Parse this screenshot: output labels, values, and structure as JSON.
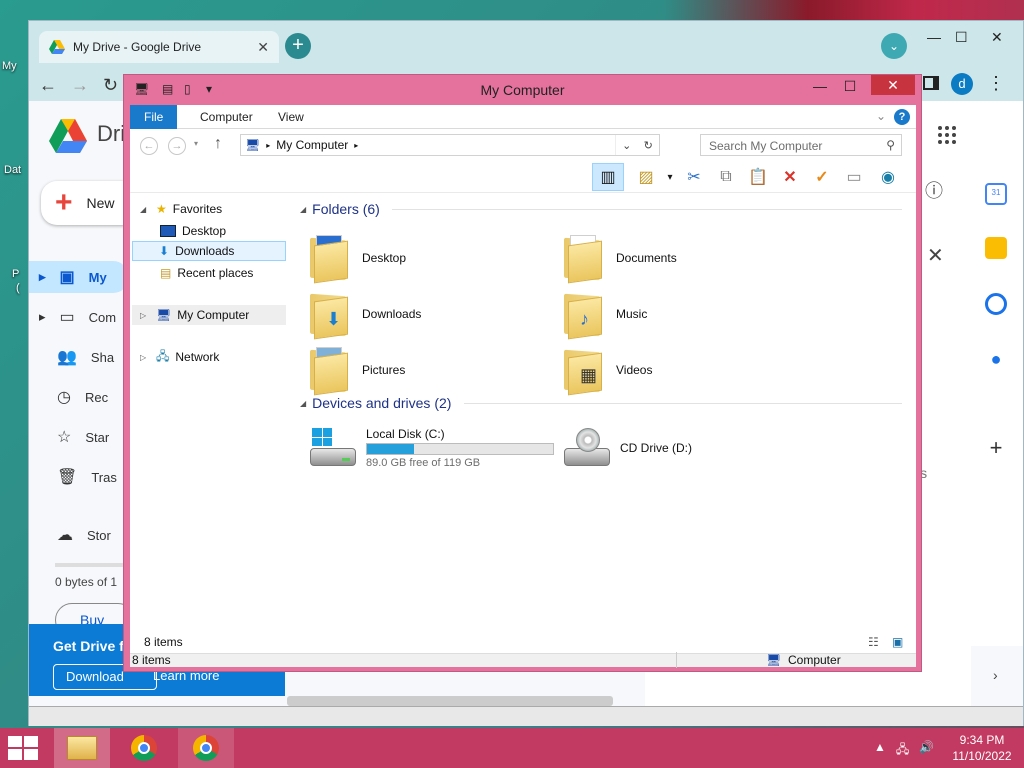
{
  "desktop": {
    "labels": [
      "My",
      "Dat",
      "P",
      "("
    ]
  },
  "chrome": {
    "tab_title": "My Drive - Google Drive",
    "avatar_letter": "d",
    "window_controls": [
      "—",
      "☐",
      "✕"
    ]
  },
  "drive": {
    "brand_partial": "Dri",
    "new_label": "New",
    "nav": [
      {
        "label": "My",
        "icon": "my-drive-icon",
        "active": true
      },
      {
        "label": "Com",
        "icon": "computers-icon"
      },
      {
        "label": "Sha",
        "icon": "shared-icon"
      },
      {
        "label": "Rec",
        "icon": "recent-icon"
      },
      {
        "label": "Star",
        "icon": "star-icon"
      },
      {
        "label": "Tras",
        "icon": "trash-icon"
      }
    ],
    "storage_label": "Stor",
    "storage_text": "0 bytes of 1",
    "buy_label": "Buy st",
    "promo_title": "Get Drive f",
    "promo_download": "Download",
    "promo_learn": "Learn more",
    "avatar_letter": "d",
    "partial_text": "ls"
  },
  "explorer": {
    "title": "My Computer",
    "ribbon_tabs": [
      "File",
      "Computer",
      "View"
    ],
    "address": "My Computer",
    "search_placeholder": "Search My Computer",
    "nav_pane": {
      "favorites": "Favorites",
      "desktop": "Desktop",
      "downloads": "Downloads",
      "recent": "Recent places",
      "my_computer": "My Computer",
      "network": "Network"
    },
    "folders_header": "Folders (6)",
    "folders": [
      "Desktop",
      "Documents",
      "Downloads",
      "Music",
      "Pictures",
      "Videos"
    ],
    "devices_header": "Devices and drives (2)",
    "local_disk": {
      "name": "Local Disk (C:)",
      "free_text": "89.0 GB free of 119 GB",
      "used_fraction": 0.25
    },
    "cd_drive": {
      "name": "CD Drive (D:)"
    },
    "item_count": "8 items",
    "status_count": "8 items",
    "status_location": "Computer"
  },
  "taskbar": {
    "time": "9:34 PM",
    "date": "11/10/2022",
    "colors": {
      "taskbar": "#c23a61",
      "accent": "#1979ca"
    }
  }
}
